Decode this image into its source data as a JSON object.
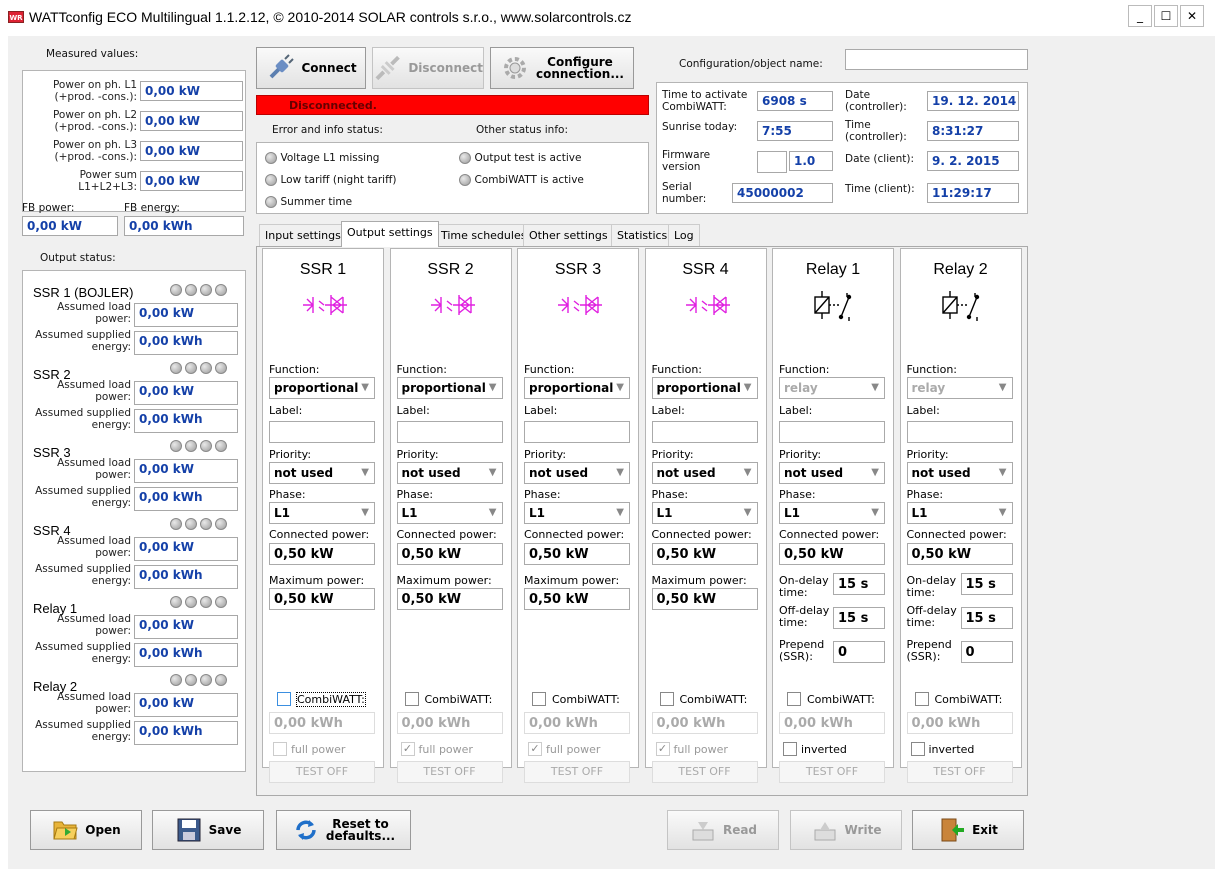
{
  "window": {
    "title": "WATTconfig ECO Multilingual 1.1.2.12, © 2010-2014 SOLAR controls s.r.o., www.solarcontrols.cz",
    "icon_text": "WR"
  },
  "measured": {
    "title": "Measured values:",
    "rows": [
      {
        "label": "Power on ph. L1\n(+prod. -cons.):",
        "value": "0,00 kW"
      },
      {
        "label": "Power on ph. L2\n(+prod. -cons.):",
        "value": "0,00 kW"
      },
      {
        "label": "Power on ph. L3\n(+prod. -cons.):",
        "value": "0,00 kW"
      },
      {
        "label": "Power sum\nL1+L2+L3:",
        "value": "0,00 kW"
      }
    ],
    "fb_power_label": "FB power:",
    "fb_energy_label": "FB energy:",
    "fb_power": "0,00 kW",
    "fb_energy": "0,00 kWh"
  },
  "toolbar": {
    "connect": "Connect",
    "disconnect": "Disconnect",
    "configure": "Configure\nconnection..."
  },
  "status": {
    "text": "Disconnected.",
    "color": "#ff0000",
    "error_title": "Error and info status:",
    "other_title": "Other status info:",
    "errors": [
      "Voltage L1 missing",
      "Low tariff (night tariff)",
      "Summer time"
    ],
    "others": [
      "Output test is active",
      "CombiWATT is active"
    ]
  },
  "config": {
    "label": "Configuration/object name:",
    "value": ""
  },
  "info": {
    "time_to_activate_label": "Time to activate\nCombiWATT:",
    "time_to_activate": "6908 s",
    "sunrise_label": "Sunrise today:",
    "sunrise": "7:55",
    "firmware_label": "Firmware\nversion",
    "firmware": "1.0",
    "serial_label": "Serial\nnumber:",
    "serial": "45000002",
    "date_ctrl_label": "Date\n(controller):",
    "date_ctrl": "19. 12. 2014",
    "time_ctrl_label": "Time\n(controller):",
    "time_ctrl": "8:31:27",
    "date_client_label": "Date (client):",
    "date_client": "9. 2. 2015",
    "time_client_label": "Time (client):",
    "time_client": "11:29:17"
  },
  "tabs": [
    "Input settings",
    "Output settings",
    "Time schedules",
    "Other settings",
    "Statistics",
    "Log"
  ],
  "output_status": {
    "title": "Output status:",
    "power_label": "Assumed load\npower:",
    "energy_label": "Assumed supplied\nenergy:",
    "items": [
      {
        "name": "SSR 1 (BOJLER)",
        "power": "0,00 kW",
        "energy": "0,00 kWh"
      },
      {
        "name": "SSR 2",
        "power": "0,00 kW",
        "energy": "0,00 kWh"
      },
      {
        "name": "SSR 3",
        "power": "0,00 kW",
        "energy": "0,00 kWh"
      },
      {
        "name": "SSR 4",
        "power": "0,00 kW",
        "energy": "0,00 kWh"
      },
      {
        "name": "Relay 1",
        "power": "0,00 kW",
        "energy": "0,00 kWh"
      },
      {
        "name": "Relay 2",
        "power": "0,00 kW",
        "energy": "0,00 kWh"
      }
    ]
  },
  "labels": {
    "function": "Function:",
    "label": "Label:",
    "priority": "Priority:",
    "phase": "Phase:",
    "connected": "Connected power:",
    "maximum": "Maximum power:",
    "on_delay": "On-delay\ntime:",
    "off_delay": "Off-delay\ntime:",
    "prepend": "Prepend\n(SSR):",
    "combiwatt": "CombiWATT:",
    "full_power": "full power",
    "inverted": "inverted",
    "test": "TEST OFF"
  },
  "outputs": [
    {
      "title": "SSR 1",
      "function": "proportional",
      "priority": "not used",
      "phase": "L1",
      "connected": "0,50 kW",
      "maximum": "0,50 kW",
      "kwh": "0,00 kWh"
    },
    {
      "title": "SSR 2",
      "function": "proportional",
      "priority": "not used",
      "phase": "L1",
      "connected": "0,50 kW",
      "maximum": "0,50 kW",
      "kwh": "0,00 kWh"
    },
    {
      "title": "SSR 3",
      "function": "proportional",
      "priority": "not used",
      "phase": "L1",
      "connected": "0,50 kW",
      "maximum": "0,50 kW",
      "kwh": "0,00 kWh"
    },
    {
      "title": "SSR 4",
      "function": "proportional",
      "priority": "not used",
      "phase": "L1",
      "connected": "0,50 kW",
      "maximum": "0,50 kW",
      "kwh": "0,00 kWh"
    },
    {
      "title": "Relay 1",
      "function": "relay",
      "priority": "not used",
      "phase": "L1",
      "connected": "0,50 kW",
      "on_delay": "15 s",
      "off_delay": "15 s",
      "prepend": "0",
      "kwh": "0,00 kWh"
    },
    {
      "title": "Relay 2",
      "function": "relay",
      "priority": "not used",
      "phase": "L1",
      "connected": "0,50 kW",
      "on_delay": "15 s",
      "off_delay": "15 s",
      "prepend": "0",
      "kwh": "0,00 kWh"
    }
  ],
  "bottom": {
    "open": "Open",
    "save": "Save",
    "reset": "Reset to\ndefaults...",
    "read": "Read",
    "write": "Write",
    "exit": "Exit"
  }
}
